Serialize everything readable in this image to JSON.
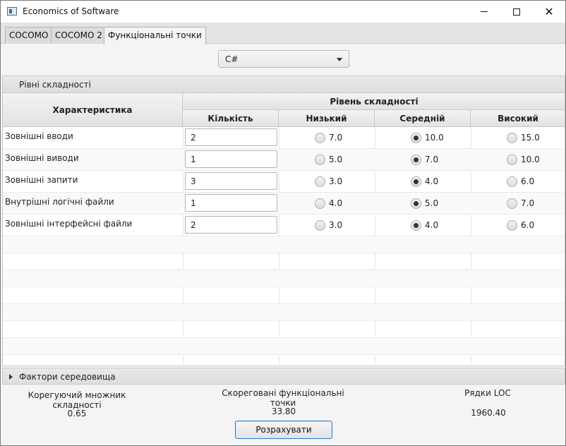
{
  "window": {
    "title": "Economics of Software"
  },
  "tabs": [
    {
      "label": "COCOMO"
    },
    {
      "label": "COCOMO 2"
    },
    {
      "label": "Функціональні точки"
    }
  ],
  "language_select": {
    "value": "C#"
  },
  "complexity_pane": {
    "title": "Рівні складності"
  },
  "table": {
    "col_characteristic": "Характеристика",
    "group_complexity": "Рівень складності",
    "col_quantity": "Кількість",
    "col_low": "Низький",
    "col_medium": "Середній",
    "col_high": "Високий",
    "rows": [
      {
        "name": "Зовнішні вводи",
        "quantity": "2",
        "low": "7.0",
        "medium": "10.0",
        "high": "15.0",
        "selected": "medium"
      },
      {
        "name": "Зовнішні виводи",
        "quantity": "1",
        "low": "5.0",
        "medium": "7.0",
        "high": "10.0",
        "selected": "medium"
      },
      {
        "name": "Зовнішні запити",
        "quantity": "3",
        "low": "3.0",
        "medium": "4.0",
        "high": "6.0",
        "selected": "medium"
      },
      {
        "name": "Внутрішні логічні файли",
        "quantity": "1",
        "low": "4.0",
        "medium": "5.0",
        "high": "7.0",
        "selected": "medium"
      },
      {
        "name": "Зовнішні інтерфейсні файли",
        "quantity": "2",
        "low": "3.0",
        "medium": "4.0",
        "high": "6.0",
        "selected": "medium"
      }
    ]
  },
  "env_pane": {
    "title": "Фактори середовища"
  },
  "results": {
    "adjust_label": "Корегуючий множник складності",
    "adjust_value": "0.65",
    "fp_label": "Скореговані функціональні точки",
    "fp_value": "33.80",
    "loc_label": "Рядки LOC",
    "loc_value": "1960.40"
  },
  "calculate_button": {
    "label": "Розрахувати"
  },
  "colors": {
    "accent": "#2f7cc9",
    "header_bg": "#e4e4e4"
  }
}
